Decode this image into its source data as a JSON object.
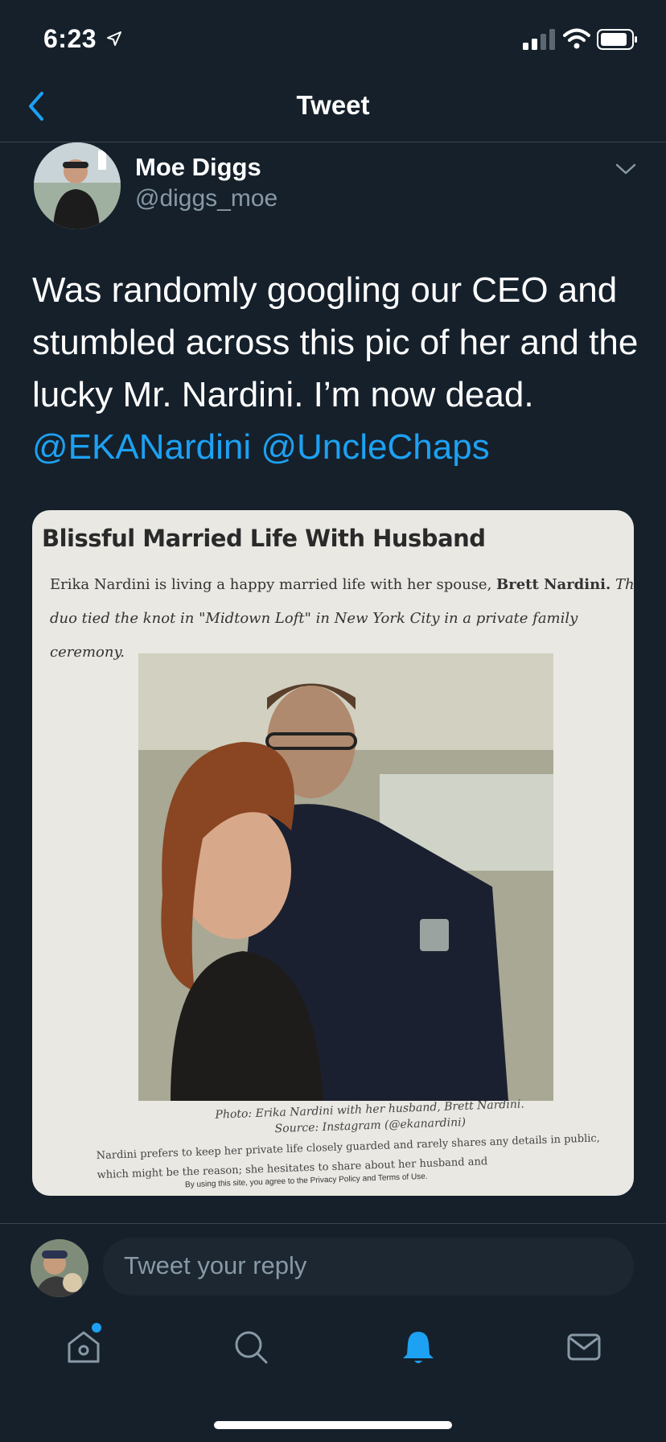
{
  "status_bar": {
    "time": "6:23"
  },
  "nav": {
    "title": "Tweet"
  },
  "author": {
    "name": "Moe Diggs",
    "handle": "@diggs_moe"
  },
  "tweet": {
    "text": "Was randomly googling our CEO and stumbled across this pic of her and the lucky Mr. Nardini. I’m now dead.",
    "mentions": [
      "@EKANardini",
      "@UncleChaps"
    ]
  },
  "media": {
    "title": "Blissful Married Life With Husband",
    "paragraph_1": "Erika Nardini is living a happy married life with her spouse, ",
    "paragraph_bold": "Brett Nardini.",
    "paragraph_2": " The duo tied the knot in \"Midtown Loft\" in New York City in a private family ceremony.",
    "caption_line1": "Photo: Erika Nardini with her husband, Brett Nardini.",
    "caption_line2": "Source: Instagram (@ekanardini)",
    "footer_text": "Nardini prefers to keep her private life closely guarded and rarely shares any details in public, which might be the reason; she hesitates to share about her husband and",
    "legal_text": "By using this site, you agree to the Privacy Policy and Terms of Use."
  },
  "reply": {
    "placeholder": "Tweet your reply"
  },
  "tabbar": {
    "items": [
      "home-icon",
      "search-icon",
      "notifications-icon",
      "messages-icon"
    ],
    "active": "notifications-icon"
  },
  "colors": {
    "background": "#15202b",
    "accent": "#1da1f2",
    "secondary_text": "#8899a6"
  }
}
